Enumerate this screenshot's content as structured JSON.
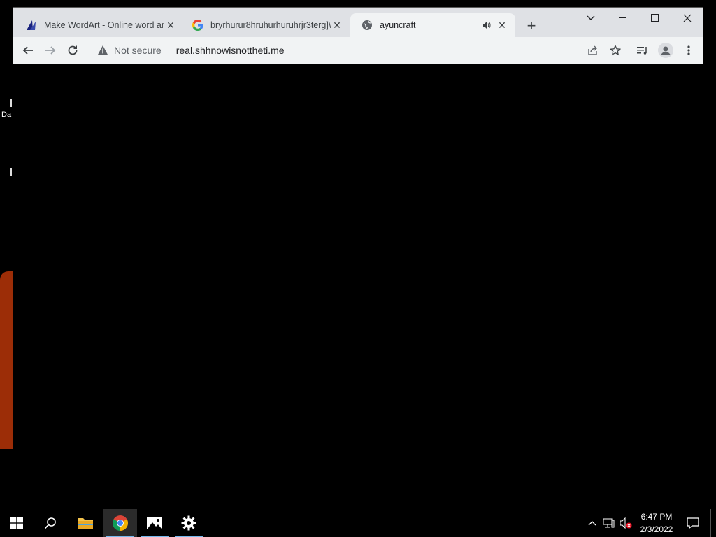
{
  "desktop": {
    "icon_text": "Da"
  },
  "browser": {
    "tabs": [
      {
        "title": "Make WordArt - Online word art",
        "favicon": "wordart-icon",
        "active": false
      },
      {
        "title": "bryrhurur8hruhurhuruhrjr3terg]\\",
        "favicon": "google-icon",
        "active": false
      },
      {
        "title": "ayuncraft",
        "favicon": "globe-icon",
        "active": true,
        "audio": true
      }
    ],
    "omnibox": {
      "security_label": "Not secure",
      "url": "real.shhnowisnottheti.me"
    }
  },
  "taskbar": {
    "time": "6:47 PM",
    "date": "2/3/2022"
  },
  "colors": {
    "tab_strip": "#dfe1e5",
    "toolbar": "#f1f3f4",
    "page": "#000000",
    "accent": "#76b9ed"
  }
}
